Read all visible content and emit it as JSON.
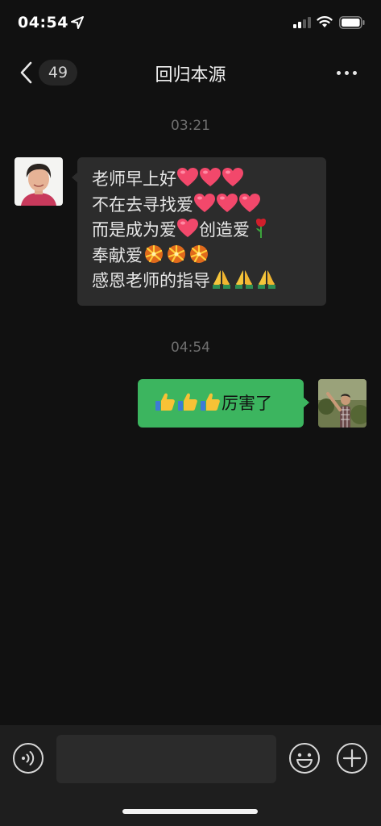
{
  "status": {
    "time": "04:54",
    "icons": [
      "location-arrow-icon",
      "cellular-signal-icon",
      "wifi-icon",
      "battery-icon"
    ]
  },
  "header": {
    "unread_count": "49",
    "title": "回归本源",
    "icons": [
      "back-chevron-icon",
      "more-dots-icon"
    ]
  },
  "messages": [
    {
      "timestamp": "03:21",
      "sender": "other",
      "lines": [
        {
          "text": "老师早上好",
          "emoji": [
            "heart",
            "heart",
            "heart"
          ]
        },
        {
          "text": "不在去寻找爱",
          "emoji": [
            "heart",
            "heart",
            "heart"
          ]
        },
        {
          "text": "而是成为爱",
          "emoji": [
            "heart"
          ],
          "text2": "创造爱",
          "emoji2": [
            "rose"
          ]
        },
        {
          "text": "奉献爱",
          "emoji": [
            "firework",
            "firework",
            "firework"
          ]
        },
        {
          "text": "感恩老师的指导",
          "emoji": [
            "pray",
            "pray",
            "pray"
          ]
        }
      ]
    },
    {
      "timestamp": "04:54",
      "sender": "self",
      "emoji": [
        "thumbs-up",
        "thumbs-up",
        "thumbs-up"
      ],
      "text": "厉害了"
    }
  ],
  "composer": {
    "value": "",
    "icons": [
      "voice-icon",
      "emoji-face-icon",
      "plus-icon"
    ]
  },
  "colors": {
    "background": "#111111",
    "incoming_bubble": "#2c2c2c",
    "outgoing_bubble": "#3cb55f",
    "composer_bar": "#1e1e1e"
  }
}
